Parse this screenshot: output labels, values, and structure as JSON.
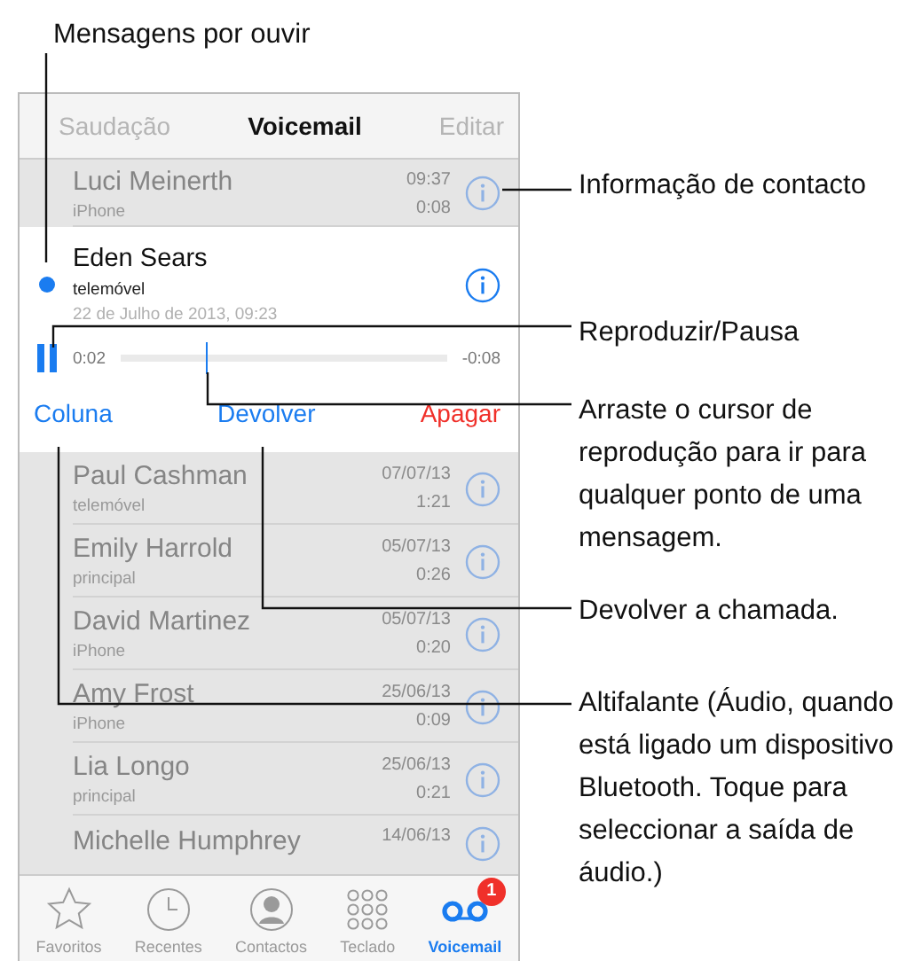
{
  "nav": {
    "left": "Saudação",
    "title": "Voicemail",
    "right": "Editar"
  },
  "messages": [
    {
      "name": "Luci Meinerth",
      "type": "iPhone",
      "time": "09:37",
      "duration": "0:08",
      "expanded": false,
      "unheard": false
    },
    {
      "name": "Eden Sears",
      "type": "telemóvel",
      "date": "22 de Julho de 2013, 09:23",
      "expanded": true,
      "unheard": true
    },
    {
      "name": "Paul Cashman",
      "type": "telemóvel",
      "time": "07/07/13",
      "duration": "1:21",
      "expanded": false,
      "unheard": false
    },
    {
      "name": "Emily Harrold",
      "type": "principal",
      "time": "05/07/13",
      "duration": "0:26",
      "expanded": false,
      "unheard": false
    },
    {
      "name": "David Martinez",
      "type": "iPhone",
      "time": "05/07/13",
      "duration": "0:20",
      "expanded": false,
      "unheard": false
    },
    {
      "name": "Amy Frost",
      "type": "iPhone",
      "time": "25/06/13",
      "duration": "0:09",
      "expanded": false,
      "unheard": false
    },
    {
      "name": "Lia Longo",
      "type": "principal",
      "time": "25/06/13",
      "duration": "0:21",
      "expanded": false,
      "unheard": false
    },
    {
      "name": "Michelle Humphrey",
      "time": "14/06/13",
      "expanded": false,
      "unheard": false
    }
  ],
  "player": {
    "playing": true,
    "elapsed": "0:02",
    "remaining": "-0:08",
    "level": 0.26
  },
  "actions": [
    {
      "label": "Coluna",
      "color": "#1a7cf0"
    },
    {
      "label": "Devolver",
      "color": "#1a7cf0"
    },
    {
      "label": "Apagar",
      "color": "#f0302a"
    }
  ],
  "tabs": [
    {
      "label": "Favoritos",
      "kind": "star",
      "selected": false
    },
    {
      "label": "Recentes",
      "kind": "clock",
      "selected": false
    },
    {
      "label": "Contactos",
      "kind": "person",
      "selected": false
    },
    {
      "label": "Teclado",
      "kind": "keypad",
      "selected": false
    },
    {
      "label": "Voicemail",
      "kind": "voicemail",
      "selected": true,
      "badge": "1"
    }
  ],
  "callouts": [
    {
      "text": "Mensagens por ouvir"
    },
    {
      "text": "Informação de contacto"
    },
    {
      "text": "Reproduzir/Pausa"
    },
    {
      "text": "Arraste o cursor de reprodução para ir para qualquer ponto de uma mensagem."
    },
    {
      "text": "Devolver a chamada."
    },
    {
      "text": "Altifalante (Áudio, quando está ligado um dispositivo Bluetooth. Toque para seleccionar a saída de áudio.)"
    }
  ]
}
